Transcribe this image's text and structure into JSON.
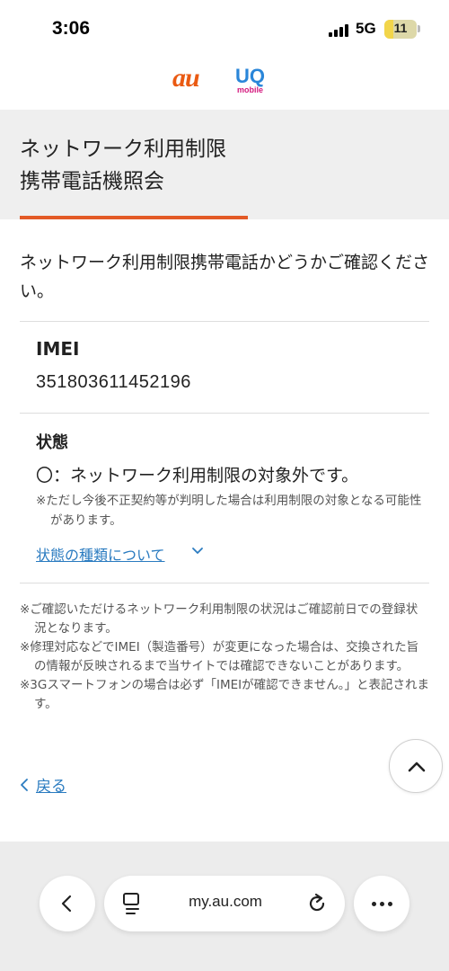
{
  "status_bar": {
    "time": "3:06",
    "network": "5G",
    "battery": "11"
  },
  "header": {
    "logo_au": "au",
    "logo_uq": "UQ",
    "logo_uq_sub": "mobile"
  },
  "page": {
    "title_line1": "ネットワーク利用制限",
    "title_line2": "携帯電話機照会",
    "intro": "ネットワーク利用制限携帯電話かどうかご確認ください。"
  },
  "result": {
    "imei_label": "IMEI",
    "imei_value": "351803611452196",
    "status_label": "状態",
    "status_text": "〇：ネットワーク利用制限の対象外です。",
    "status_note": "※ただし今後不正契約等が判明した場合は利用制限の対象となる可能性があります。",
    "status_types_link": "状態の種類について"
  },
  "notes": [
    "※ご確認いただけるネットワーク利用制限の状況はご確認前日での登録状況となります。",
    "※修理対応などでIMEI（製造番号）が変更になった場合は、交換された旨の情報が反映されるまで当サイトでは確認できないことがあります。",
    "※3Gスマートフォンの場合は必ず「IMEIが確認できません。」と表記されます。"
  ],
  "navigation": {
    "back_label": "戻る"
  },
  "browser": {
    "url": "my.au.com"
  },
  "colors": {
    "accent": "#e35a26",
    "link": "#2a7bc0",
    "title_band": "#efefef",
    "au_brand": "#ea5a12"
  },
  "icons": [
    "signal-icon",
    "battery-icon",
    "chevron-down-icon",
    "chevron-left-icon",
    "chevron-up-icon",
    "tabs-icon",
    "reload-icon",
    "more-icon"
  ]
}
